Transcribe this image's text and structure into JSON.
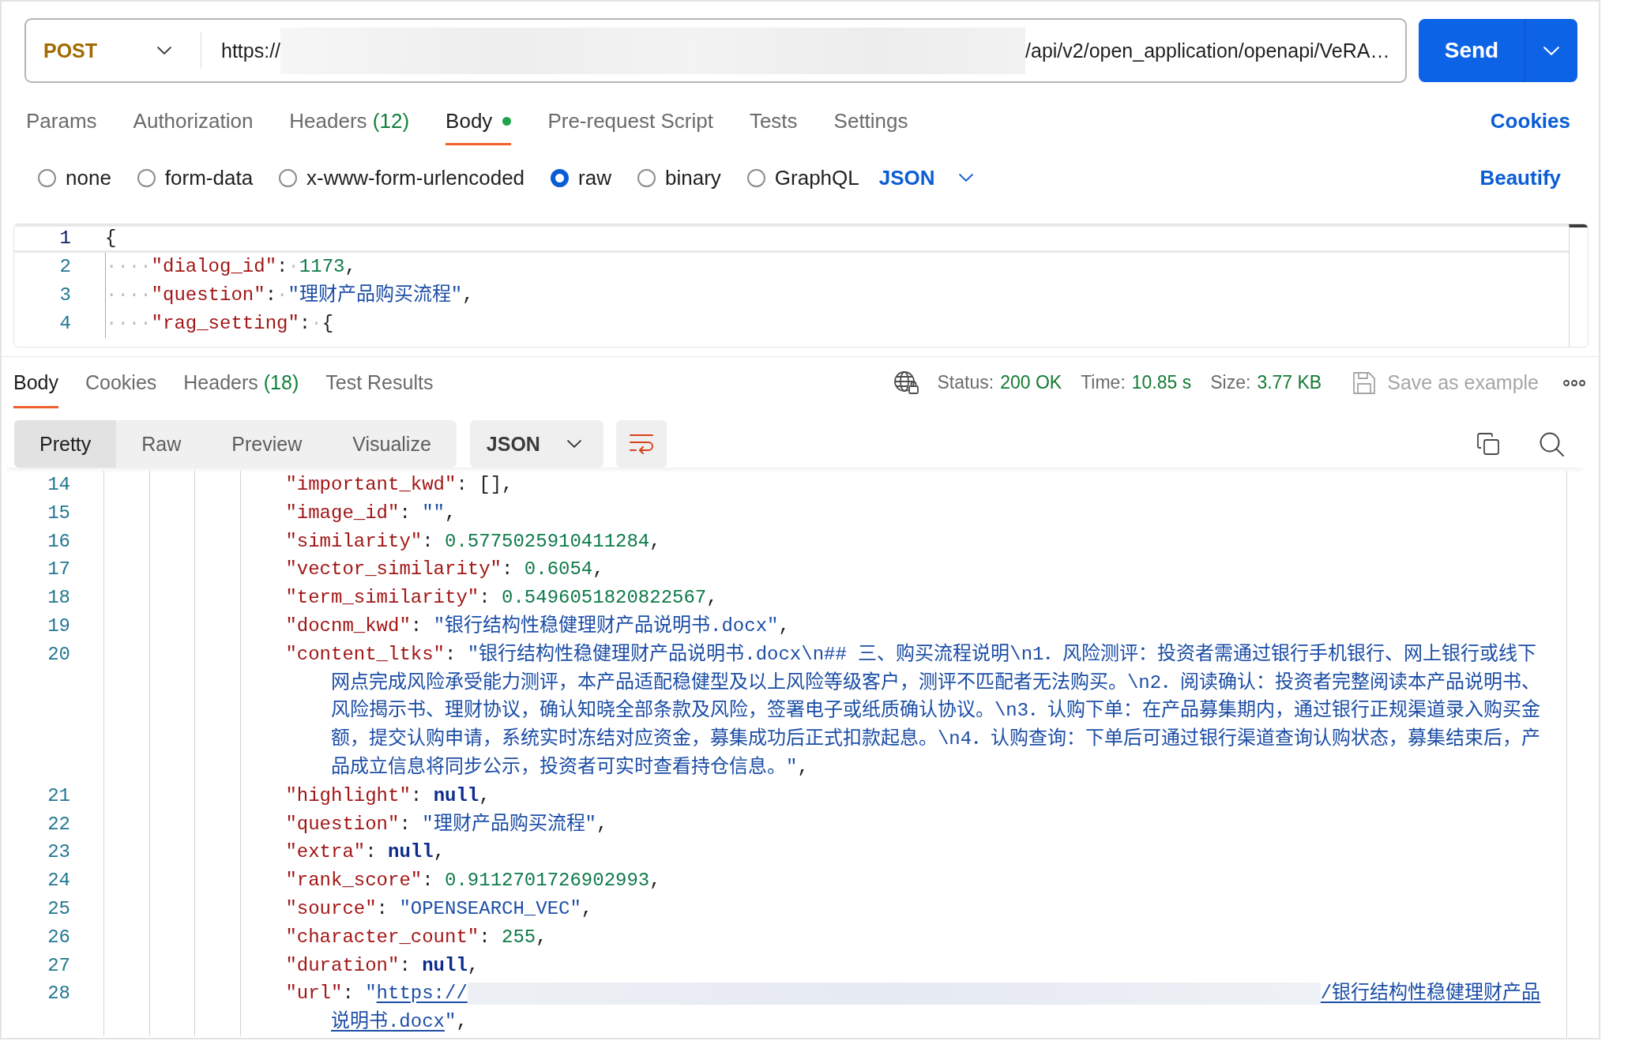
{
  "request_bar": {
    "method": "POST",
    "url": [
      {
        "kind": "text",
        "text": "https://"
      },
      {
        "kind": "redacted"
      },
      {
        "kind": "text",
        "text": "/api/v2/open_application/openapi/VeRA…"
      }
    ],
    "send": "Send"
  },
  "request_tabs": [
    {
      "label": "Params",
      "selected": false,
      "indicator": false
    },
    {
      "label": "Authorization",
      "selected": false,
      "indicator": false
    },
    {
      "label": "Headers",
      "count": "(12)",
      "selected": false,
      "indicator": false
    },
    {
      "label": "Body",
      "selected": true,
      "indicator": true
    },
    {
      "label": "Pre-request Script",
      "selected": false,
      "indicator": false
    },
    {
      "label": "Tests",
      "selected": false,
      "indicator": false
    },
    {
      "label": "Settings",
      "selected": false,
      "indicator": false
    }
  ],
  "cookies_link": "Cookies",
  "body_types": [
    {
      "label": "none",
      "selected": false
    },
    {
      "label": "form-data",
      "selected": false
    },
    {
      "label": "x-www-form-urlencoded",
      "selected": false
    },
    {
      "label": "raw",
      "selected": true
    },
    {
      "label": "binary",
      "selected": false
    },
    {
      "label": "GraphQL",
      "selected": false
    }
  ],
  "body_format": "JSON",
  "beautify": "Beautify",
  "request_body": {
    "lines": [
      {
        "number": "1",
        "active": true,
        "tokens": [
          {
            "kind": "punct",
            "text": "{"
          }
        ]
      },
      {
        "number": "2",
        "active": false,
        "tokens": [
          {
            "kind": "space",
            "text": "····"
          },
          {
            "kind": "key",
            "text": "\"dialog_id\""
          },
          {
            "kind": "punct",
            "text": ":"
          },
          {
            "kind": "space",
            "text": "·"
          },
          {
            "kind": "number",
            "text": "1173"
          },
          {
            "kind": "punct",
            "text": ","
          }
        ]
      },
      {
        "number": "3",
        "active": false,
        "tokens": [
          {
            "kind": "space",
            "text": "····"
          },
          {
            "kind": "key",
            "text": "\"question\""
          },
          {
            "kind": "punct",
            "text": ":"
          },
          {
            "kind": "space",
            "text": "·"
          },
          {
            "kind": "string",
            "text": "\"理财产品购买流程\""
          },
          {
            "kind": "punct",
            "text": ","
          }
        ]
      },
      {
        "number": "4",
        "active": false,
        "tokens": [
          {
            "kind": "space",
            "text": "····"
          },
          {
            "kind": "key",
            "text": "\"rag_setting\""
          },
          {
            "kind": "punct",
            "text": ":"
          },
          {
            "kind": "space",
            "text": "·"
          },
          {
            "kind": "punct",
            "text": "{"
          }
        ]
      }
    ]
  },
  "response_tabs": [
    {
      "label": "Body",
      "selected": true
    },
    {
      "label": "Cookies",
      "selected": false
    },
    {
      "label": "Headers",
      "count": "(18)",
      "selected": false
    },
    {
      "label": "Test Results",
      "selected": false
    }
  ],
  "response_stats": [
    {
      "label": "Status:",
      "value": "200 OK"
    },
    {
      "label": "Time:",
      "value": "10.85 s"
    },
    {
      "label": "Size:",
      "value": "3.77 KB"
    }
  ],
  "save_example": {
    "label": "Save as example",
    "disabled": true
  },
  "view_modes": [
    {
      "label": "Pretty",
      "selected": true
    },
    {
      "label": "Raw",
      "selected": false
    },
    {
      "label": "Preview",
      "selected": false
    },
    {
      "label": "Visualize",
      "selected": false
    }
  ],
  "response_format": "JSON",
  "wrap_lines": {
    "on": true
  },
  "response_body": {
    "lines": [
      {
        "number": "14",
        "tokens": [
          {
            "kind": "key",
            "text": "\"important_kwd\""
          },
          {
            "kind": "punct",
            "text": ": [],"
          }
        ]
      },
      {
        "number": "15",
        "tokens": [
          {
            "kind": "key",
            "text": "\"image_id\""
          },
          {
            "kind": "punct",
            "text": ": "
          },
          {
            "kind": "string",
            "text": "\"\""
          },
          {
            "kind": "punct",
            "text": ","
          }
        ]
      },
      {
        "number": "16",
        "tokens": [
          {
            "kind": "key",
            "text": "\"similarity\""
          },
          {
            "kind": "punct",
            "text": ": "
          },
          {
            "kind": "number",
            "text": "0.5775025910411284"
          },
          {
            "kind": "punct",
            "text": ","
          }
        ]
      },
      {
        "number": "17",
        "tokens": [
          {
            "kind": "key",
            "text": "\"vector_similarity\""
          },
          {
            "kind": "punct",
            "text": ": "
          },
          {
            "kind": "number",
            "text": "0.6054"
          },
          {
            "kind": "punct",
            "text": ","
          }
        ]
      },
      {
        "number": "18",
        "tokens": [
          {
            "kind": "key",
            "text": "\"term_similarity\""
          },
          {
            "kind": "punct",
            "text": ": "
          },
          {
            "kind": "number",
            "text": "0.5496051820822567"
          },
          {
            "kind": "punct",
            "text": ","
          }
        ]
      },
      {
        "number": "19",
        "tokens": [
          {
            "kind": "key",
            "text": "\"docnm_kwd\""
          },
          {
            "kind": "punct",
            "text": ": "
          },
          {
            "kind": "string",
            "text": "\"银行结构性稳健理财产品说明书.docx\""
          },
          {
            "kind": "punct",
            "text": ","
          }
        ]
      },
      {
        "number": "20",
        "tokens": [
          {
            "kind": "key",
            "text": "\"content_ltks\""
          },
          {
            "kind": "punct",
            "text": ": "
          },
          {
            "kind": "string",
            "text": "\"银行结构性稳健理财产品说明书.docx\\n## 三、购买流程说明\\n1．风险测评：投资者需通过银行手机银行、网上银行或线下网点完成风险承受能力测评，本产品适配稳健型及以上风险等级客户，测评不匹配者无法购买。\\n2．阅读确认：投资者完整阅读本产品说明书、风险揭示书、理财协议，确认知晓全部条款及风险，签署电子或纸质确认协议。\\n3．认购下单：在产品募集期内，通过银行正规渠道录入购买金额，提交认购申请，系统实时冻结对应资金，募集成功后正式扣款起息。\\n4．认购查询：下单后可通过银行渠道查询认购状态，募集结束后，产品成立信息将同步公示，投资者可实时查看持仓信息。\""
          },
          {
            "kind": "punct",
            "text": ","
          }
        ]
      },
      {
        "number": "21",
        "tokens": [
          {
            "kind": "key",
            "text": "\"highlight\""
          },
          {
            "kind": "punct",
            "text": ": "
          },
          {
            "kind": "keyword",
            "text": "null"
          },
          {
            "kind": "punct",
            "text": ","
          }
        ]
      },
      {
        "number": "22",
        "tokens": [
          {
            "kind": "key",
            "text": "\"question\""
          },
          {
            "kind": "punct",
            "text": ": "
          },
          {
            "kind": "string",
            "text": "\"理财产品购买流程\""
          },
          {
            "kind": "punct",
            "text": ","
          }
        ]
      },
      {
        "number": "23",
        "tokens": [
          {
            "kind": "key",
            "text": "\"extra\""
          },
          {
            "kind": "punct",
            "text": ": "
          },
          {
            "kind": "keyword",
            "text": "null"
          },
          {
            "kind": "punct",
            "text": ","
          }
        ]
      },
      {
        "number": "24",
        "tokens": [
          {
            "kind": "key",
            "text": "\"rank_score\""
          },
          {
            "kind": "punct",
            "text": ": "
          },
          {
            "kind": "number",
            "text": "0.9112701726902993"
          },
          {
            "kind": "punct",
            "text": ","
          }
        ]
      },
      {
        "number": "25",
        "tokens": [
          {
            "kind": "key",
            "text": "\"source\""
          },
          {
            "kind": "punct",
            "text": ": "
          },
          {
            "kind": "string",
            "text": "\"OPENSEARCH_VEC\""
          },
          {
            "kind": "punct",
            "text": ","
          }
        ]
      },
      {
        "number": "26",
        "tokens": [
          {
            "kind": "key",
            "text": "\"character_count\""
          },
          {
            "kind": "punct",
            "text": ": "
          },
          {
            "kind": "number",
            "text": "255"
          },
          {
            "kind": "punct",
            "text": ","
          }
        ]
      },
      {
        "number": "27",
        "tokens": [
          {
            "kind": "key",
            "text": "\"duration\""
          },
          {
            "kind": "punct",
            "text": ": "
          },
          {
            "kind": "keyword",
            "text": "null"
          },
          {
            "kind": "punct",
            "text": ","
          }
        ]
      },
      {
        "number": "28",
        "tokens": [
          {
            "kind": "key",
            "text": "\"url\""
          },
          {
            "kind": "punct",
            "text": ": "
          },
          {
            "kind": "string",
            "text": "\""
          },
          {
            "kind": "link",
            "parts": [
              {
                "kind": "text",
                "text": "https://"
              },
              {
                "kind": "redacted"
              },
              {
                "kind": "text",
                "text": "/银行结构性稳健理财产品说明书.docx"
              }
            ]
          },
          {
            "kind": "string",
            "text": "\""
          },
          {
            "kind": "punct",
            "text": ","
          }
        ]
      }
    ]
  }
}
